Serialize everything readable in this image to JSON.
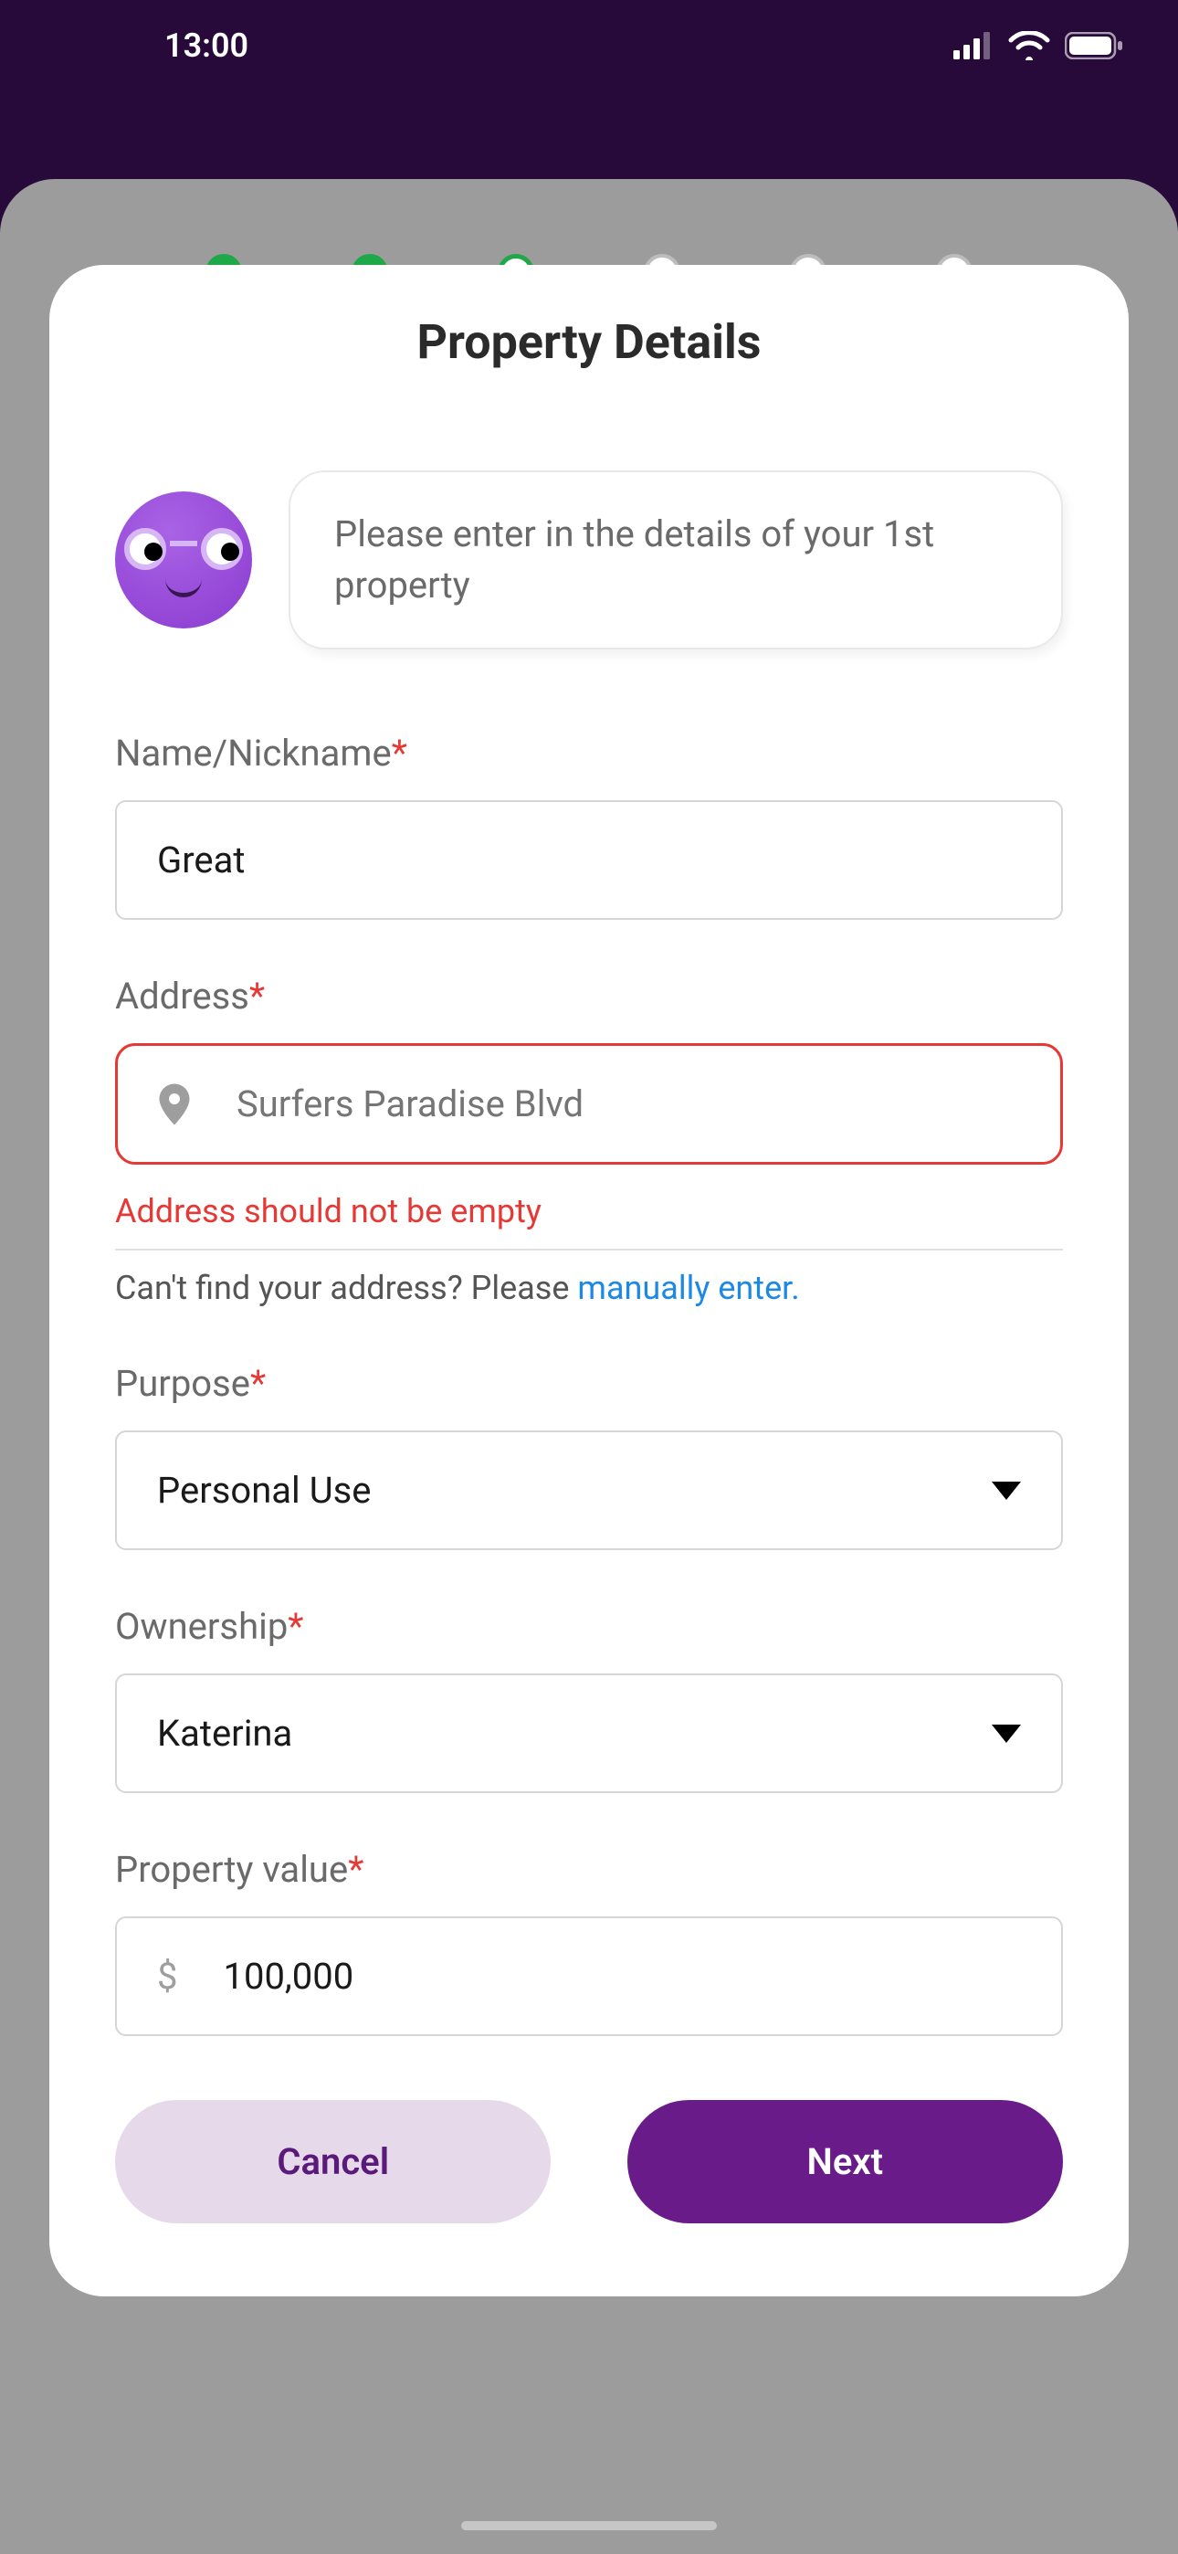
{
  "status": {
    "time": "13:00"
  },
  "modal": {
    "title": "Property Details",
    "intro": "Please enter in the details of your 1st property"
  },
  "form": {
    "name": {
      "label": "Name/Nickname",
      "value": "Great"
    },
    "address": {
      "label": "Address",
      "placeholder": "Surfers Paradise Blvd",
      "error": "Address should not be empty",
      "helper_prefix": "Can't find your address? Please ",
      "helper_link": "manually enter."
    },
    "purpose": {
      "label": "Purpose",
      "value": "Personal Use"
    },
    "ownership": {
      "label": "Ownership",
      "value": "Katerina"
    },
    "property_value": {
      "label": "Property value",
      "currency": "$",
      "value": "100,000"
    }
  },
  "buttons": {
    "cancel": "Cancel",
    "next": "Next"
  }
}
